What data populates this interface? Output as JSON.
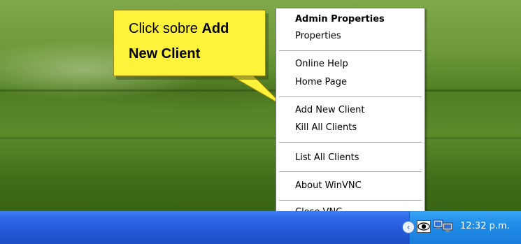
{
  "callout": {
    "text_plain": "Click sobre ",
    "text_bold_1": "Add",
    "text_bold_2": "New Client"
  },
  "context_menu": {
    "items": [
      {
        "label": "Admin Properties",
        "bold": true
      },
      {
        "label": "Properties"
      },
      {
        "label": "Online Help"
      },
      {
        "label": "Home Page"
      },
      {
        "label": "Add New Client"
      },
      {
        "label": "Kill All Clients"
      },
      {
        "label": "List All Clients"
      },
      {
        "label": "About WinVNC"
      },
      {
        "label": "Close VNC"
      }
    ]
  },
  "taskbar": {
    "clock": "12:32 p.m.",
    "tray_icons": [
      "chevron-left-icon",
      "winvnc-eye-icon",
      "network-icon",
      "vnc-icon"
    ]
  },
  "colors": {
    "callout_fill": "#fff23a",
    "taskbar": "#2458d8",
    "tray": "#1f8de8"
  }
}
